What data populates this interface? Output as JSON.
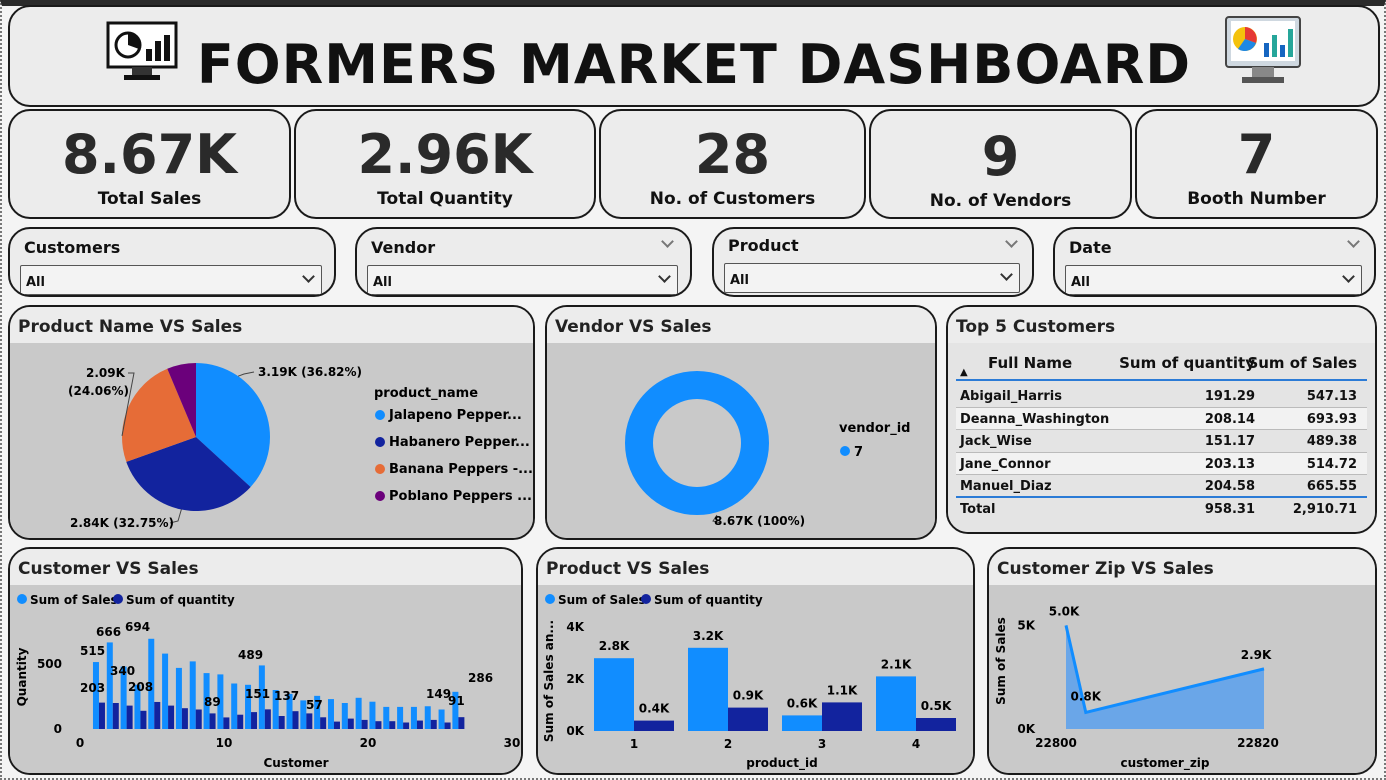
{
  "header": {
    "title": "FORMERS MARKET DASHBOARD",
    "left_icon": "monitor-chart-icon",
    "right_icon": "monitor-analytics-icon"
  },
  "kpis": [
    {
      "value": "8.67K",
      "label": "Total Sales"
    },
    {
      "value": "2.96K",
      "label": "Total Quantity"
    },
    {
      "value": "28",
      "label": "No. of Customers"
    },
    {
      "value": "9",
      "label": "No. of Vendors"
    },
    {
      "value": "7",
      "label": "Booth Number"
    }
  ],
  "slicers": [
    {
      "title": "Customers",
      "value": "All"
    },
    {
      "title": "Vendor",
      "value": "All"
    },
    {
      "title": "Product",
      "value": "All"
    },
    {
      "title": "Date",
      "value": "All"
    }
  ],
  "colors": {
    "light_blue": "#118dff",
    "dark_blue": "#12239e",
    "orange": "#e66c37",
    "purple": "#6b007b",
    "area": "#6aa6e8"
  },
  "panels": {
    "product_pie": "Product Name VS Sales",
    "vendor_donut": "Vendor VS Sales",
    "top5": "Top 5 Customers",
    "customer_bar": "Customer VS Sales",
    "product_bar": "Product VS Sales",
    "zip_area": "Customer Zip VS Sales"
  },
  "top5": {
    "columns": [
      "Full Name",
      "Sum of quantity",
      "Sum of Sales"
    ],
    "rows": [
      [
        "Abigail_Harris",
        "191.29",
        "547.13"
      ],
      [
        "Deanna_Washington",
        "208.14",
        "693.93"
      ],
      [
        "Jack_Wise",
        "151.17",
        "489.38"
      ],
      [
        "Jane_Connor",
        "203.13",
        "514.72"
      ],
      [
        "Manuel_Diaz",
        "204.58",
        "665.55"
      ]
    ],
    "total": [
      "Total",
      "958.31",
      "2,910.71"
    ]
  },
  "chart_data": [
    {
      "type": "pie",
      "legend_title": "product_name",
      "slices": [
        {
          "name": "Jalapeno Pepper...",
          "value": 3.19,
          "label": "3.19K (36.82%)",
          "color": "#118dff"
        },
        {
          "name": "Habanero Pepper...",
          "value": 2.84,
          "label": "2.84K (32.75%)",
          "color": "#12239e"
        },
        {
          "name": "Banana Peppers -...",
          "value": 2.09,
          "label": "2.09K",
          "label2": "(24.06%)",
          "color": "#e66c37"
        },
        {
          "name": "Poblano Peppers ...",
          "value": 0.55,
          "label": "",
          "color": "#6b007b"
        }
      ]
    },
    {
      "type": "pie",
      "legend_title": "vendor_id",
      "slices": [
        {
          "name": "7",
          "value": 8.67,
          "label": "8.67K (100%)",
          "color": "#118dff"
        }
      ]
    },
    {
      "type": "bar",
      "legend": [
        "Sum of Sales",
        "Sum of quantity"
      ],
      "xlabel": "Customer",
      "ylabel": "Quantity",
      "xticks": [
        "0",
        "10",
        "20",
        "30"
      ],
      "yticks": [
        "0",
        "500"
      ],
      "xlim": [
        0,
        30
      ],
      "ylim": [
        0,
        800
      ],
      "x": [
        1,
        2,
        3,
        4,
        5,
        6,
        7,
        8,
        9,
        10,
        11,
        12,
        13,
        14,
        15,
        16,
        17,
        18,
        19,
        20,
        21,
        22,
        23,
        24,
        25,
        26
      ],
      "series": [
        {
          "name": "Sum of Sales",
          "values": [
            515,
            666,
            480,
            340,
            694,
            580,
            470,
            520,
            430,
            420,
            350,
            340,
            489,
            300,
            270,
            220,
            255,
            230,
            200,
            240,
            210,
            170,
            170,
            170,
            175,
            150,
            286
          ]
        },
        {
          "name": "Sum of quantity",
          "values": [
            203,
            200,
            180,
            140,
            208,
            180,
            160,
            150,
            120,
            89,
            110,
            130,
            151,
            100,
            137,
            120,
            90,
            57,
            80,
            70,
            60,
            60,
            50,
            65,
            70,
            50,
            91
          ]
        }
      ],
      "labels": [
        {
          "x": 1,
          "text": "515",
          "s": 0
        },
        {
          "x": 2,
          "text": "666",
          "s": 0
        },
        {
          "x": 4,
          "text": "694",
          "s": 0
        },
        {
          "x": 3,
          "text": "340",
          "s": 0
        },
        {
          "x": 1,
          "text": "203",
          "s": 1
        },
        {
          "x": 4,
          "text": "208",
          "s": 1
        },
        {
          "x": 13,
          "text": "489",
          "s": 0
        },
        {
          "x": 10,
          "text": "89",
          "s": 1
        },
        {
          "x": 13,
          "text": "151",
          "s": 1
        },
        {
          "x": 15,
          "text": "137",
          "s": 1
        },
        {
          "x": 18,
          "text": "57",
          "s": 1
        },
        {
          "x": 26,
          "text": "286",
          "s": 0
        },
        {
          "x": 25,
          "text": "149",
          "s": 0
        },
        {
          "x": 26,
          "text": "91",
          "s": 1
        }
      ]
    },
    {
      "type": "bar",
      "legend": [
        "Sum of Sales",
        "Sum of quantity"
      ],
      "xlabel": "product_id",
      "ylabel": "Sum of Sales an...",
      "categories": [
        "1",
        "2",
        "3",
        "4"
      ],
      "yticks": [
        "0K",
        "2K",
        "4K"
      ],
      "ylim": [
        0,
        4
      ],
      "series": [
        {
          "name": "Sum of Sales",
          "values": [
            2.8,
            3.2,
            0.6,
            2.1
          ],
          "labels": [
            "2.8K",
            "3.2K",
            "0.6K",
            "2.1K"
          ]
        },
        {
          "name": "Sum of quantity",
          "values": [
            0.4,
            0.9,
            1.1,
            0.5
          ],
          "labels": [
            "0.4K",
            "0.9K",
            "1.1K",
            "0.5K"
          ]
        }
      ]
    },
    {
      "type": "area",
      "xlabel": "customer_zip",
      "ylabel": "Sum of Sales",
      "xticks": [
        "22800",
        "22820"
      ],
      "yticks": [
        "0K",
        "5K"
      ],
      "ylim": [
        0,
        5.5
      ],
      "points": [
        {
          "x": 0,
          "y": 5.0,
          "label": "5.0K"
        },
        {
          "x": 0.1,
          "y": 0.8,
          "label": "0.8K"
        },
        {
          "x": 1,
          "y": 2.9,
          "label": "2.9K"
        }
      ]
    }
  ]
}
